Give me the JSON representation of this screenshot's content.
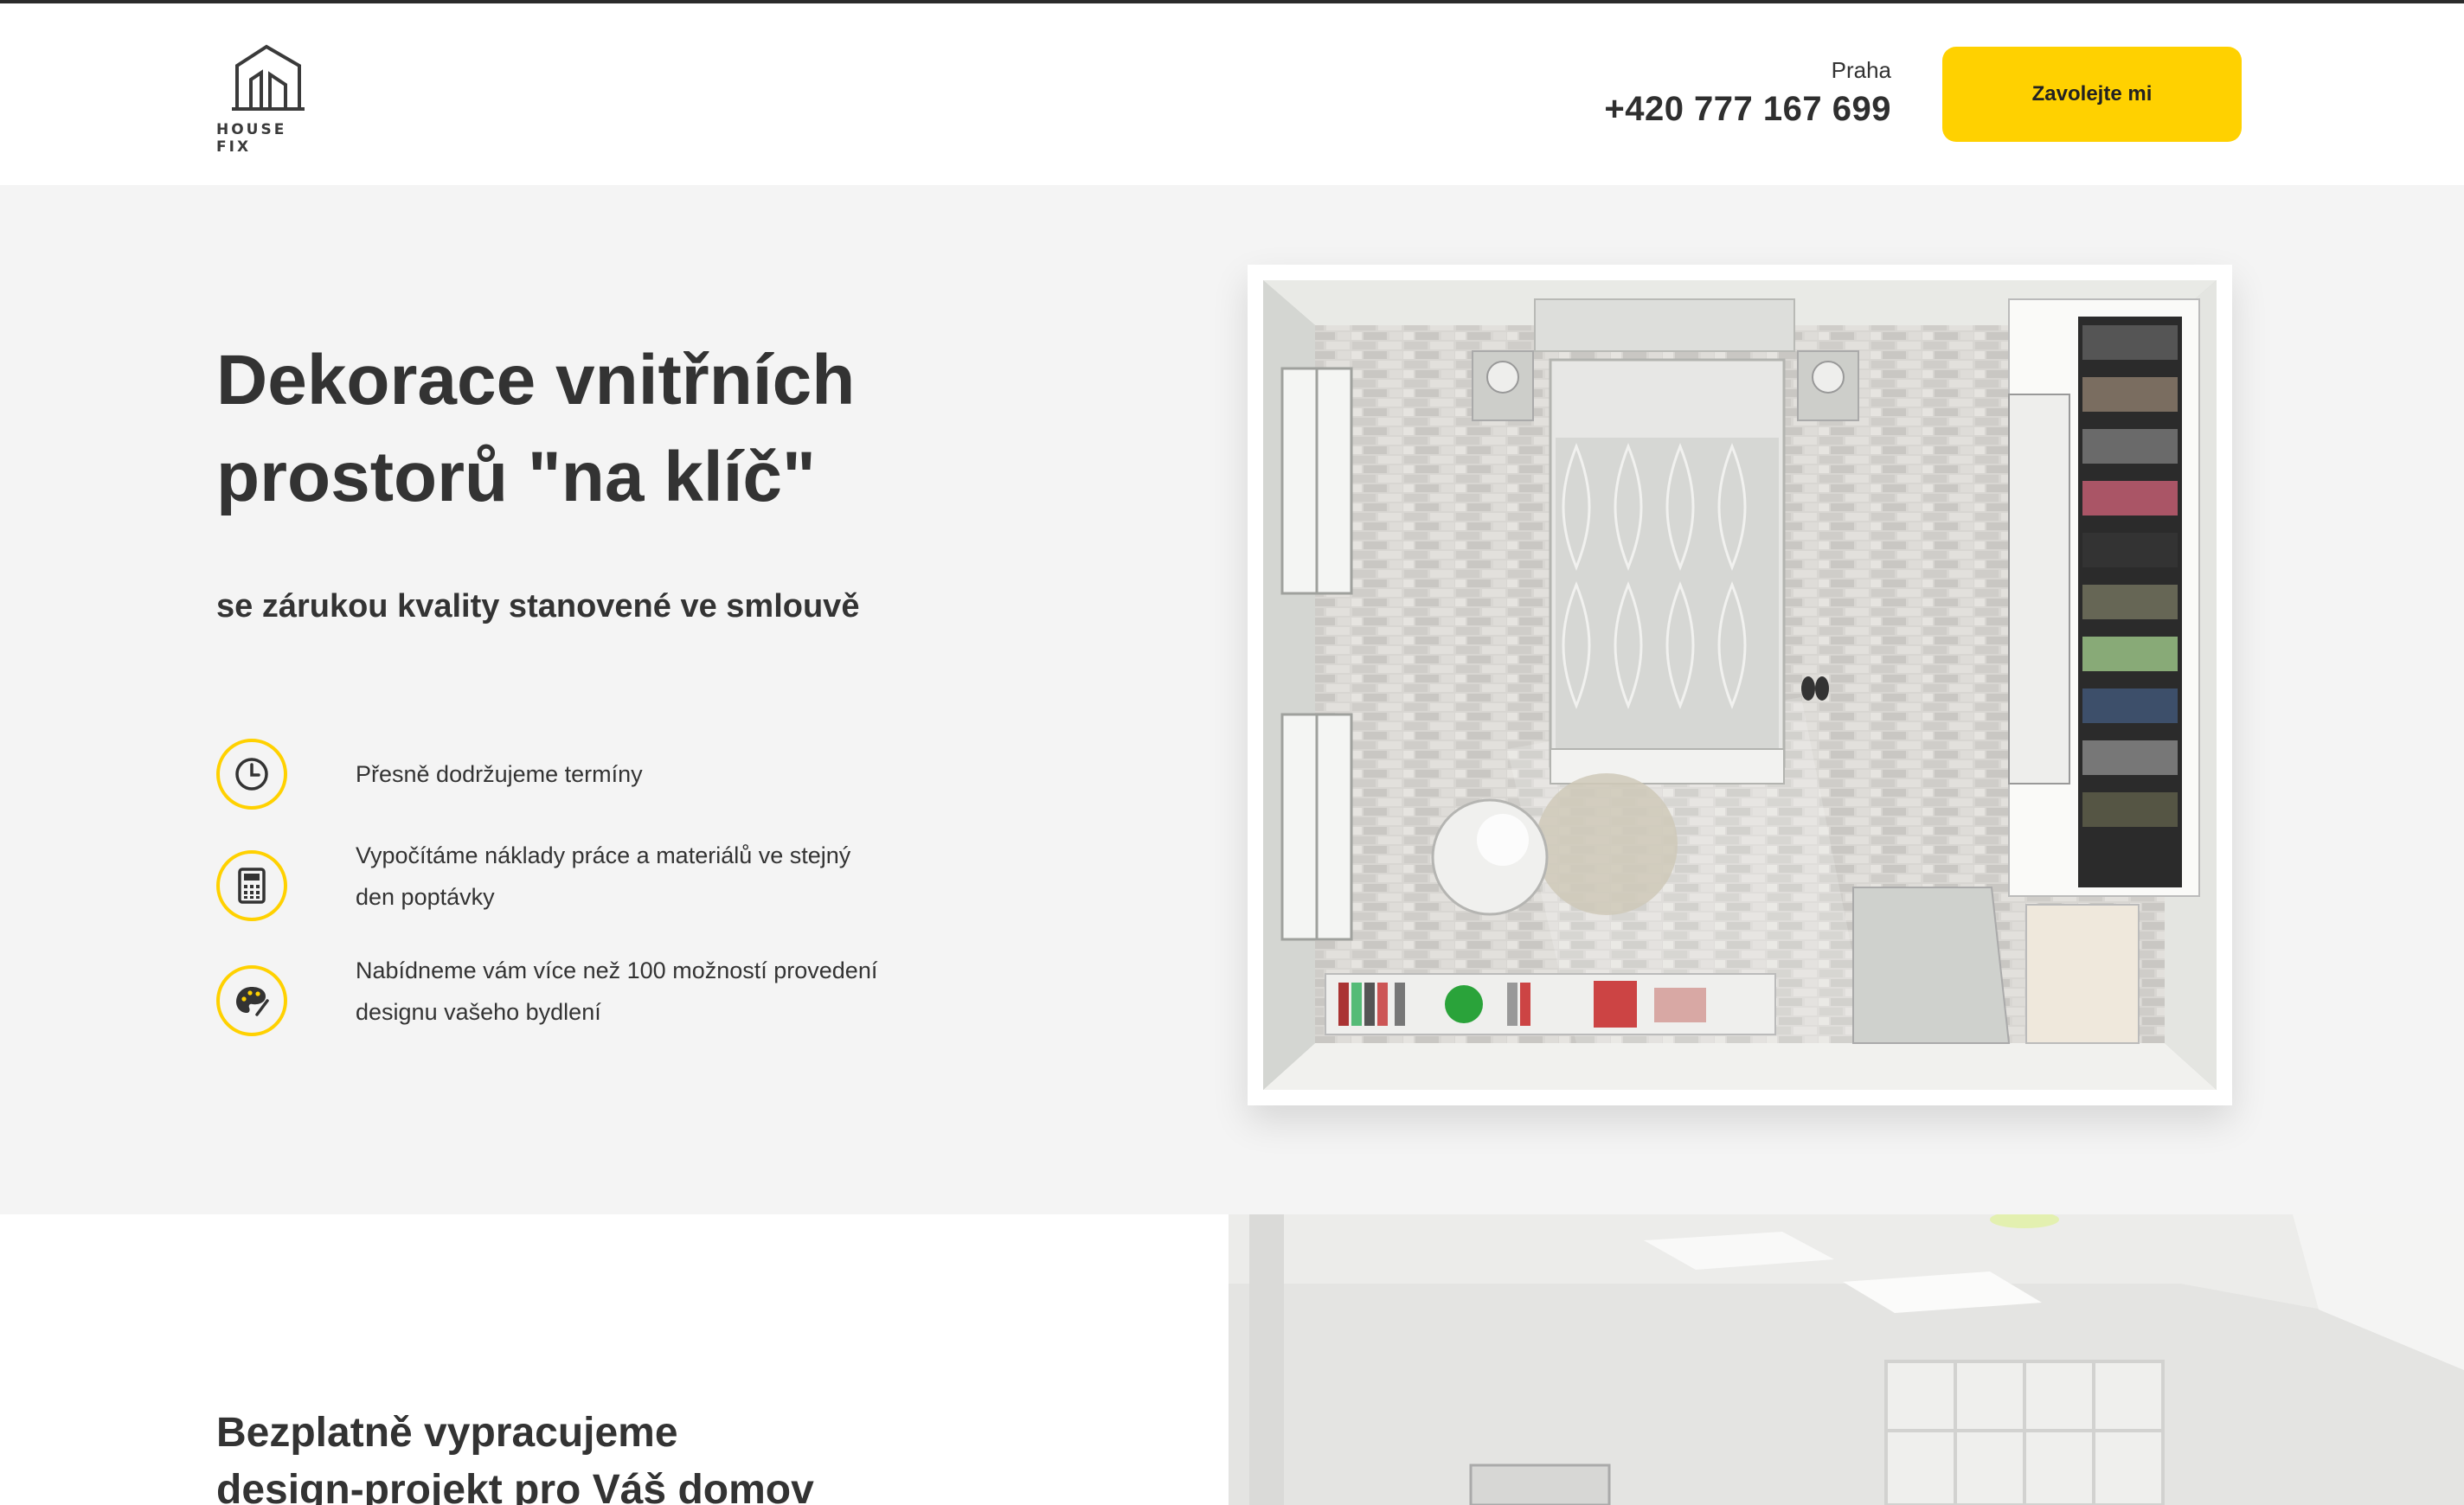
{
  "header": {
    "logo_text": "HOUSE FIX",
    "city": "Praha",
    "phone": "+420 777 167 699",
    "call_button_label": "Zavolejte mi"
  },
  "hero": {
    "title_line1": "Dekorace vnitřních",
    "title_line2": "prostorů \"na klíč\"",
    "subtitle": "se zárukou kvality stanovené ve smlouvě",
    "features": [
      {
        "icon": "clock-icon",
        "text": "Přesně dodržujeme termíny"
      },
      {
        "icon": "calculator-icon",
        "text": "Vypočítáme náklady práce a materiálů ve stejný den poptávky"
      },
      {
        "icon": "palette-icon",
        "text": "Nabídneme vám více než 100 možností provedení designu vašeho bydlení"
      }
    ],
    "image": "bedroom-floor-plan-render"
  },
  "section2": {
    "title_line1": "Bezplatně vypracujeme",
    "title_line2": "design-projekt pro Váš domov",
    "image": "interior-room-render"
  },
  "colors": {
    "accent": "#ffd100",
    "text": "#333333",
    "hero_background": "#f4f4f4",
    "page_background": "#ffffff"
  }
}
